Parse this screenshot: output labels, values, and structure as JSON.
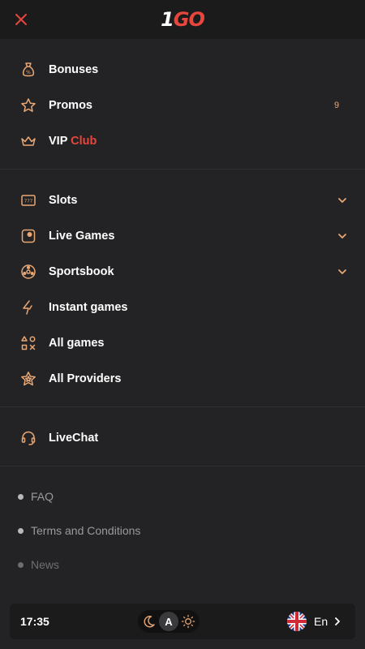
{
  "header": {
    "close_icon": "close-icon",
    "logo": {
      "one": "1",
      "go": "GO"
    }
  },
  "menu_top": [
    {
      "label": "Bonuses",
      "icon": "money-bag-icon"
    },
    {
      "label": "Promos",
      "icon": "star-icon",
      "count": "9"
    },
    {
      "label": "VIP",
      "label_accent": "Club",
      "icon": "crown-icon"
    }
  ],
  "menu_games": [
    {
      "label": "Slots",
      "icon": "slot-machine-icon",
      "expandable": true
    },
    {
      "label": "Live Games",
      "icon": "live-games-icon",
      "expandable": true
    },
    {
      "label": "Sportsbook",
      "icon": "soccer-ball-icon",
      "expandable": true
    },
    {
      "label": "Instant games",
      "icon": "lightning-icon"
    },
    {
      "label": "All games",
      "icon": "game-shapes-icon"
    },
    {
      "label": "All Providers",
      "icon": "star-badge-icon"
    }
  ],
  "support": {
    "label": "LiveChat",
    "icon": "headset-icon"
  },
  "footer_links": [
    "FAQ",
    "Terms and Conditions",
    "News"
  ],
  "bottom_bar": {
    "time": "17:35",
    "theme_auto_label": "A",
    "language": "En"
  },
  "colors": {
    "background": "#232325",
    "header": "#1b1b1c",
    "accent_red": "#e8463c",
    "icon_orange": "#e9a774"
  }
}
